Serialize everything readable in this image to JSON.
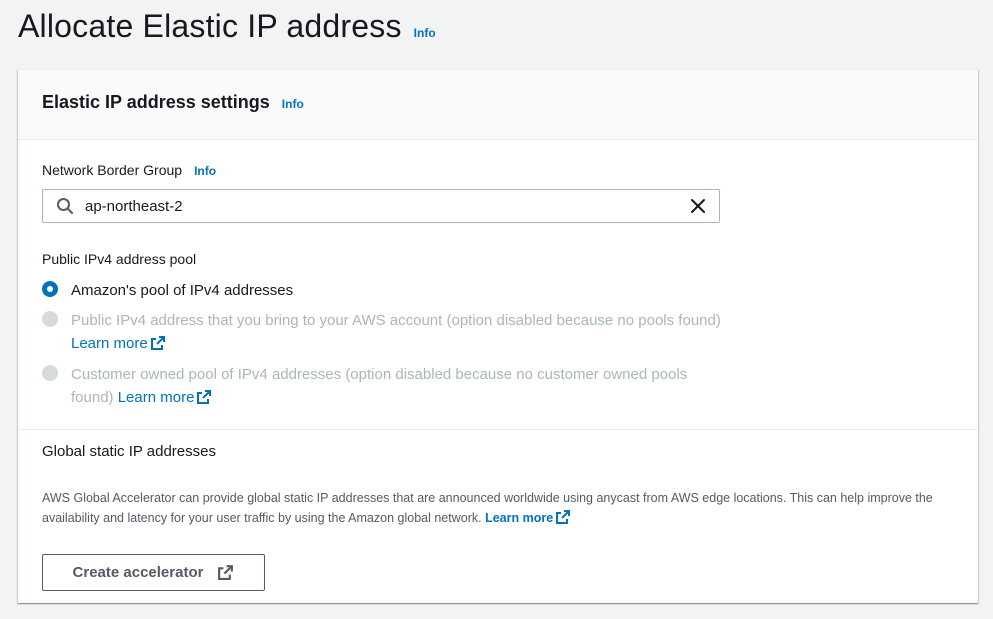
{
  "page": {
    "title": "Allocate Elastic IP address",
    "info_label": "Info"
  },
  "settings": {
    "title": "Elastic IP address settings",
    "info_label": "Info",
    "network_border_group": {
      "label": "Network Border Group",
      "info_label": "Info",
      "value": "ap-northeast-2"
    },
    "pool": {
      "label": "Public IPv4 address pool",
      "options": [
        {
          "label": "Amazon's pool of IPv4 addresses",
          "selected": true,
          "disabled": false
        },
        {
          "label": "Public IPv4 address that you bring to your AWS account (option disabled because no pools found)",
          "link": "Learn more",
          "selected": false,
          "disabled": true
        },
        {
          "label": "Customer owned pool of IPv4 addresses (option disabled because no customer owned pools found)",
          "link": "Learn more",
          "selected": false,
          "disabled": true
        }
      ]
    },
    "global": {
      "label": "Global static IP addresses",
      "description": "AWS Global Accelerator can provide global static IP addresses that are announced worldwide using anycast from AWS edge locations. This can help improve the availability and latency for your user traffic by using the Amazon global network.",
      "link": "Learn more",
      "button_label": "Create accelerator"
    }
  },
  "colors": {
    "link": "#0073bb",
    "text": "#16191f",
    "disabled": "#aab7b8",
    "background": "#f2f3f3"
  },
  "icons": [
    "search-icon",
    "close-icon",
    "external-link-icon"
  ]
}
